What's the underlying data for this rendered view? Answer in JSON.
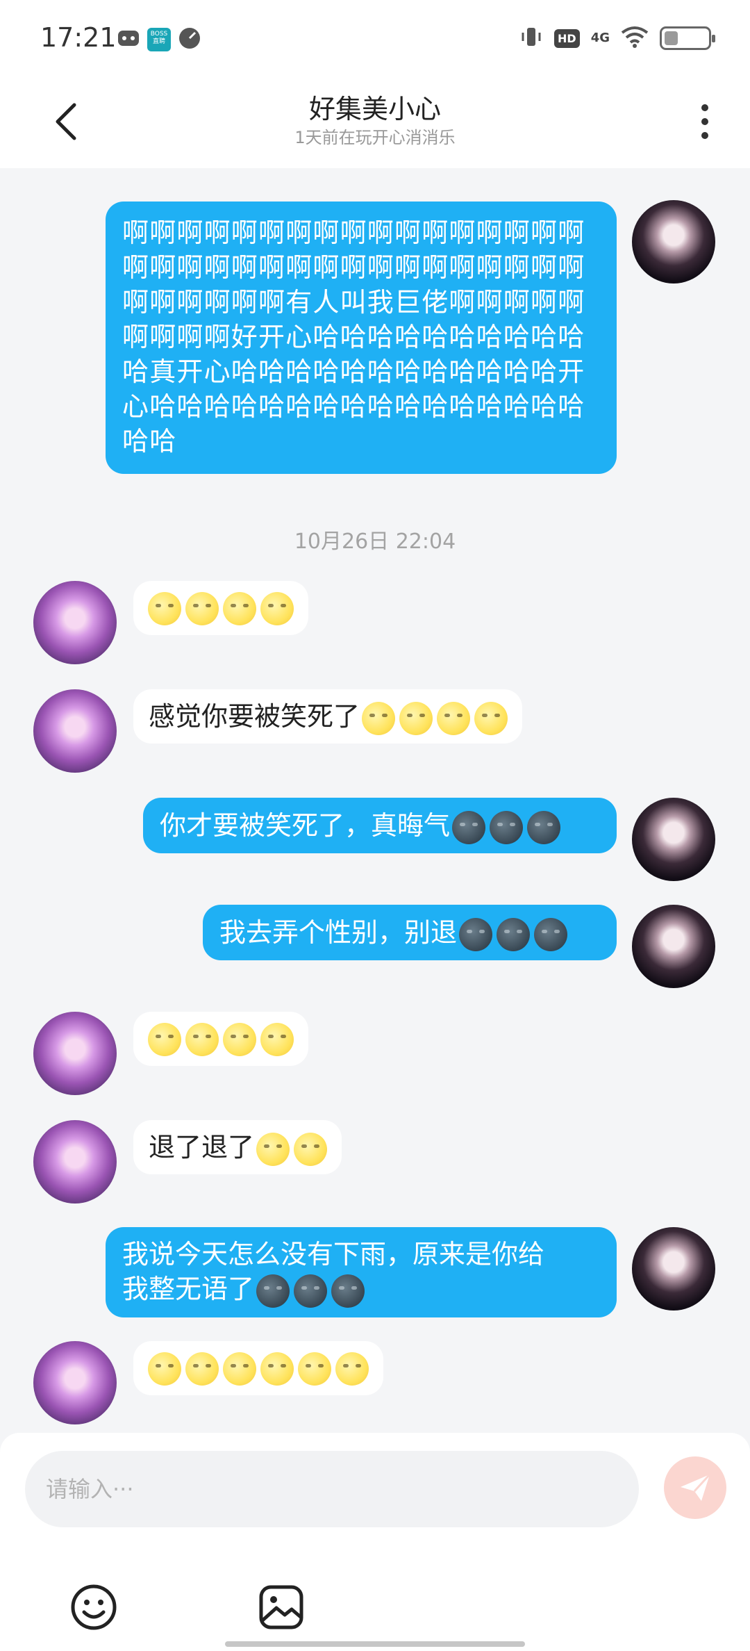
{
  "status_bar": {
    "time": "17:21",
    "boss_text": "BOSS\n直聘",
    "network": "4G",
    "hd_badge": "HD",
    "battery_level": 0.3
  },
  "header": {
    "title": "好集美小心",
    "subtitle": "1天前在玩开心消消乐"
  },
  "messages": [
    {
      "side": "me",
      "text": "啊啊啊啊啊啊啊啊啊啊啊啊啊啊啊啊啊啊啊啊啊啊啊啊啊啊啊啊啊啊啊啊啊啊啊啊啊啊啊啊有人叫我巨佬啊啊啊啊啊啊啊啊啊好开心哈哈哈哈哈哈哈哈哈哈哈真开心哈哈哈哈哈哈哈哈哈哈哈哈开心哈哈哈哈哈哈哈哈哈哈哈哈哈哈哈哈哈哈"
    },
    {
      "side": "time",
      "text": "10月26日 22:04"
    },
    {
      "side": "them",
      "text": "",
      "emoji_count": 4,
      "emoji": "moon-face"
    },
    {
      "side": "them",
      "text": "感觉你要被笑死了",
      "emoji_count": 4,
      "emoji": "moon-face"
    },
    {
      "side": "me",
      "text": "你才要被笑死了，真晦气",
      "emoji_count": 3,
      "emoji": "dark-moon-face"
    },
    {
      "side": "me",
      "text": "我去弄个性别，别退",
      "emoji_count": 3,
      "emoji": "dark-moon-face"
    },
    {
      "side": "them",
      "text": "",
      "emoji_count": 4,
      "emoji": "moon-face"
    },
    {
      "side": "them",
      "text": "退了退了",
      "emoji_count": 2,
      "emoji": "moon-face"
    },
    {
      "side": "me",
      "text_line1": "我说今天怎么没有下雨，原来是你给",
      "text_line2": "我整无语了",
      "emoji_count": 3,
      "emoji": "dark-moon-face"
    },
    {
      "side": "them",
      "text": "",
      "emoji_count": 6,
      "emoji": "moon-face"
    }
  ],
  "input": {
    "placeholder": "请输入···"
  },
  "icons": {
    "back": "chevron-left-icon",
    "more": "more-vertical-icon",
    "send": "send-icon",
    "emoji": "smile-icon",
    "image": "image-icon"
  },
  "colors": {
    "my_bubble": "#1fb0f4",
    "their_bubble": "#ffffff",
    "background": "#f4f5f7",
    "send_button": "#fbd6d0"
  }
}
